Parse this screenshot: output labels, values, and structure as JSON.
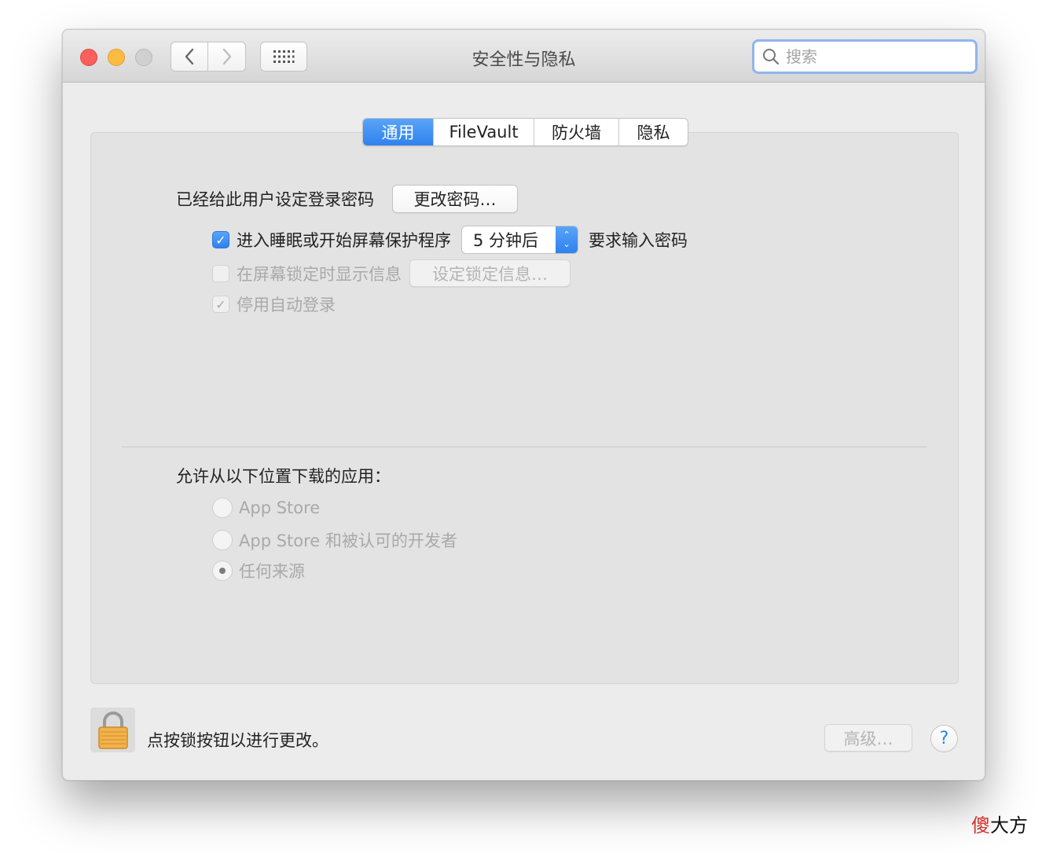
{
  "window": {
    "title": "安全性与隐私",
    "search_placeholder": "搜索"
  },
  "tabs": [
    {
      "label": "通用",
      "active": true
    },
    {
      "label": "FileVault",
      "active": false
    },
    {
      "label": "防火墙",
      "active": false
    },
    {
      "label": "隐私",
      "active": false
    }
  ],
  "general": {
    "password_label": "已经给此用户设定登录密码",
    "change_password_button": "更改密码…",
    "require_password": {
      "checked": true,
      "label": "进入睡眠或开始屏幕保护程序",
      "delay_value": "5 分钟后",
      "suffix": "要求输入密码"
    },
    "show_message": {
      "checked": false,
      "label": "在屏幕锁定时显示信息",
      "button": "设定锁定信息…"
    },
    "disable_auto_login": {
      "checked": true,
      "label": "停用自动登录"
    },
    "downloads_label": "允许从以下位置下载的应用：",
    "download_options": [
      {
        "label": "App Store",
        "selected": false
      },
      {
        "label": "App Store 和被认可的开发者",
        "selected": false
      },
      {
        "label": "任何来源",
        "selected": true
      }
    ]
  },
  "footer": {
    "lock_text": "点按锁按钮以进行更改。",
    "advanced_button": "高级…",
    "help_symbol": "?"
  },
  "watermark": {
    "accent_char": "傻",
    "rest": "大方"
  }
}
